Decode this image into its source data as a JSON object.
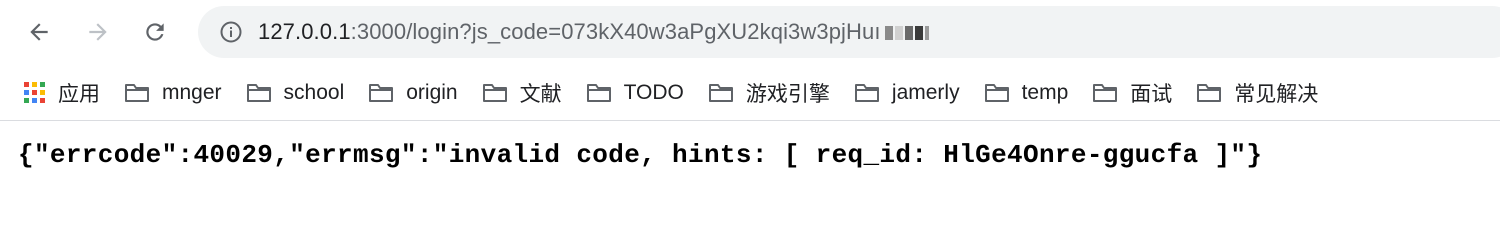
{
  "browser": {
    "url_host": "127.0.0.1",
    "url_rest": ":3000/login?js_code=073kX40w3aPgXU2kqi3w3pjHuı",
    "icons": {
      "back": "arrow-left-icon",
      "forward": "arrow-right-icon",
      "reload": "reload-icon",
      "info": "info-icon"
    }
  },
  "bookmarks": [
    {
      "label": "应用",
      "icon": "apps-grid-icon"
    },
    {
      "label": "mnger",
      "icon": "folder-icon"
    },
    {
      "label": "school",
      "icon": "folder-icon"
    },
    {
      "label": "origin",
      "icon": "folder-icon"
    },
    {
      "label": "文献",
      "icon": "folder-icon"
    },
    {
      "label": "TODO",
      "icon": "folder-icon"
    },
    {
      "label": "游戏引擎",
      "icon": "folder-icon"
    },
    {
      "label": "jamerly",
      "icon": "folder-icon"
    },
    {
      "label": "temp",
      "icon": "folder-icon"
    },
    {
      "label": "面试",
      "icon": "folder-icon"
    },
    {
      "label": "常见解决",
      "icon": "folder-icon"
    }
  ],
  "page": {
    "body_text": "{\"errcode\":40029,\"errmsg\":\"invalid code, hints: [ req_id: HlGe4Onre-ggucfa ]\"}"
  }
}
